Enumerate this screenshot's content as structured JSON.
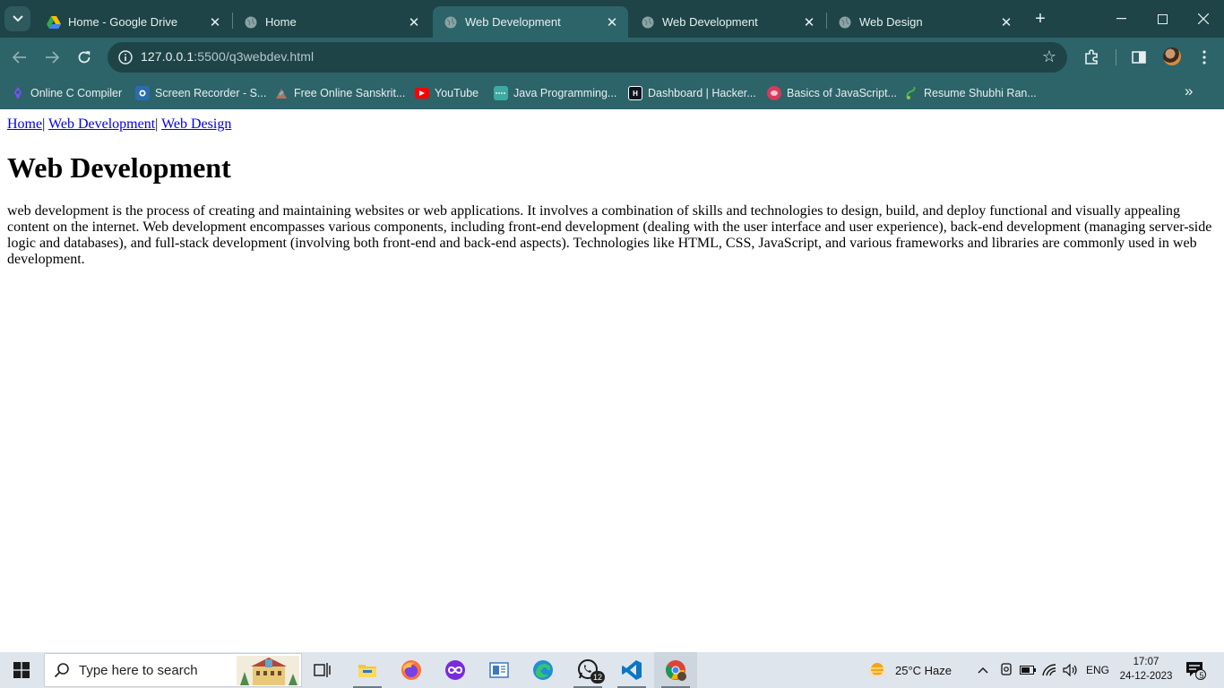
{
  "browser": {
    "tabs": [
      {
        "title": "Home - Google Drive",
        "icon": "google-drive-icon",
        "active": false
      },
      {
        "title": "Home",
        "icon": "globe-icon",
        "active": false
      },
      {
        "title": "Web Development",
        "icon": "globe-icon",
        "active": true
      },
      {
        "title": "Web Development",
        "icon": "globe-icon",
        "active": false
      },
      {
        "title": "Web Design",
        "icon": "globe-icon",
        "active": false
      }
    ],
    "url_host": "127.0.0.1",
    "url_path": ":5500/q3webdev.html",
    "bookmarks": [
      {
        "label": "Online C Compiler",
        "icon": "programiz-icon",
        "color": "#7c4dff"
      },
      {
        "label": "Screen Recorder - S...",
        "icon": "screen-recorder-icon",
        "color": "#2b6cb0"
      },
      {
        "label": "Free Online Sanskrit...",
        "icon": "sanskrit-icon",
        "color": "#8a5a44"
      },
      {
        "label": "YouTube",
        "icon": "youtube-icon",
        "color": "#ff0000"
      },
      {
        "label": "Java Programming...",
        "icon": "java-icon",
        "color": "#3fa9a3"
      },
      {
        "label": "Dashboard | Hacker...",
        "icon": "hackerrank-icon",
        "color": "#0e141e"
      },
      {
        "label": "Basics of JavaScript...",
        "icon": "javascript-icon",
        "color": "#d63b5a"
      },
      {
        "label": "Resume Shubhi Ran...",
        "icon": "resume-icon",
        "color": "#4caf50"
      }
    ]
  },
  "page": {
    "nav": [
      {
        "label": "Home",
        "sep": "|"
      },
      {
        "label": "Web Development",
        "sep": "|"
      },
      {
        "label": "Web Design",
        "sep": ""
      }
    ],
    "heading": "Web Development",
    "paragraph": "web development is the process of creating and maintaining websites or web applications. It involves a combination of skills and technologies to design, build, and deploy functional and visually appealing content on the internet. Web development encompasses various components, including front-end development (dealing with the user interface and user experience), back-end development (managing server-side logic and databases), and full-stack development (involving both front-end and back-end aspects). Technologies like HTML, CSS, JavaScript, and various frameworks and libraries are commonly used in web development."
  },
  "taskbar": {
    "search_placeholder": "Type here to search",
    "whatsapp_badge": "12",
    "weather": "25°C  Haze",
    "language": "ENG",
    "time": "17:07",
    "date": "24-12-2023",
    "notifications": "5"
  },
  "colors": {
    "tabstrip": "#1e4448",
    "toolbar": "#2c6469",
    "link": "#0000ee",
    "taskbar": "#dfe5ec"
  }
}
